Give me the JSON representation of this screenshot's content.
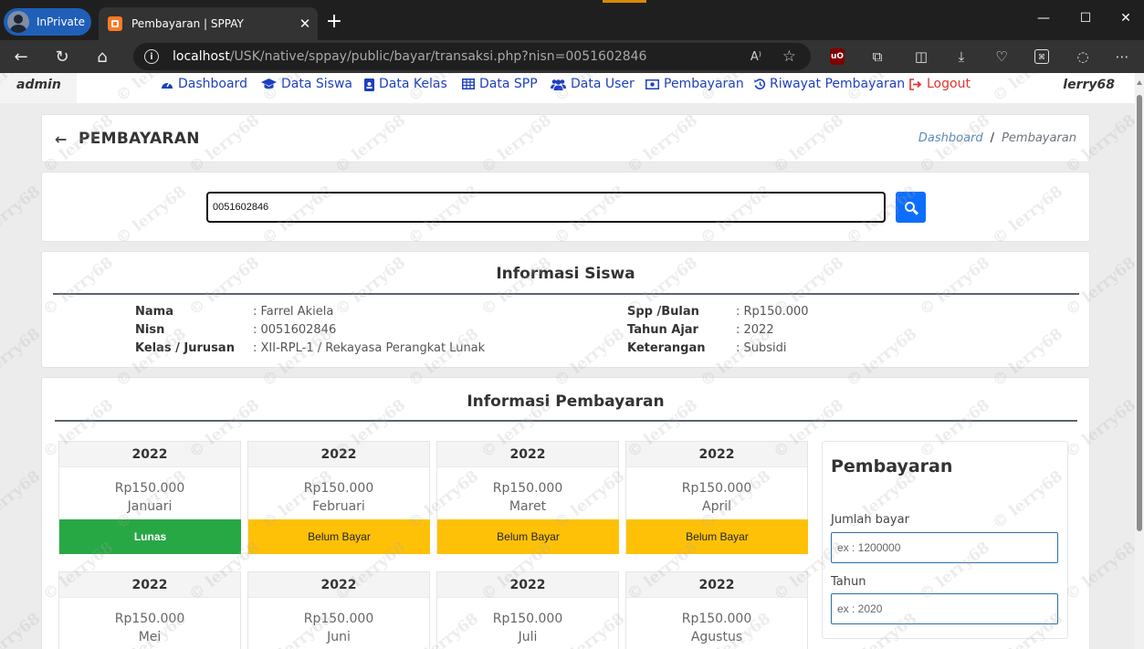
{
  "browser": {
    "inprivate_label": "InPrivate",
    "tab_title": "Pembayaran | SPPAY",
    "url_host": "localhost",
    "url_path": "/USK/native/sppay/public/bayar/transaksi.php?nisn=0051602846"
  },
  "nav": {
    "admin_label": "admin",
    "user_label": "lerry68",
    "links": [
      {
        "label": "Dashboard",
        "icon": "tachometer-icon"
      },
      {
        "label": "Data Siswa",
        "icon": "graduation-cap-icon"
      },
      {
        "label": "Data Kelas",
        "icon": "id-badge-icon"
      },
      {
        "label": "Data SPP",
        "icon": "table-icon"
      },
      {
        "label": "Data User",
        "icon": "users-icon"
      },
      {
        "label": "Pembayaran",
        "icon": "money-icon"
      },
      {
        "label": "Riwayat Pembayaran",
        "icon": "history-icon"
      },
      {
        "label": "Logout",
        "icon": "sign-out-icon"
      }
    ]
  },
  "header": {
    "title": "PEMBAYARAN",
    "breadcrumb": [
      "Dashboard",
      "Pembayaran"
    ]
  },
  "search": {
    "value": "0051602846"
  },
  "student": {
    "heading": "Informasi Siswa",
    "left": [
      {
        "key": "Nama",
        "value": ": Farrel Akiela"
      },
      {
        "key": "Nisn",
        "value": ": 0051602846"
      },
      {
        "key": "Kelas / Jurusan",
        "value": ": XII-RPL-1 / Rekayasa Perangkat Lunak"
      }
    ],
    "right": [
      {
        "key": "Spp /Bulan",
        "value": ": Rp150.000"
      },
      {
        "key": "Tahun Ajar",
        "value": ": 2022"
      },
      {
        "key": "Keterangan",
        "value": ": Subsidi"
      }
    ]
  },
  "payments": {
    "heading": "Informasi Pembayaran",
    "months": [
      {
        "year": "2022",
        "amount": "Rp150.000",
        "month": "Januari",
        "status": "Lunas",
        "paid": true
      },
      {
        "year": "2022",
        "amount": "Rp150.000",
        "month": "Februari",
        "status": "Belum Bayar",
        "paid": false
      },
      {
        "year": "2022",
        "amount": "Rp150.000",
        "month": "Maret",
        "status": "Belum Bayar",
        "paid": false
      },
      {
        "year": "2022",
        "amount": "Rp150.000",
        "month": "April",
        "status": "Belum Bayar",
        "paid": false
      },
      {
        "year": "2022",
        "amount": "Rp150.000",
        "month": "Mei",
        "status": "",
        "paid": false
      },
      {
        "year": "2022",
        "amount": "Rp150.000",
        "month": "Juni",
        "status": "",
        "paid": false
      },
      {
        "year": "2022",
        "amount": "Rp150.000",
        "month": "Juli",
        "status": "",
        "paid": false
      },
      {
        "year": "2022",
        "amount": "Rp150.000",
        "month": "Agustus",
        "status": "",
        "paid": false
      }
    ]
  },
  "form": {
    "title": "Pembayaran",
    "amount_label": "Jumlah bayar",
    "amount_placeholder": "ex : 1200000",
    "year_label": "Tahun",
    "year_placeholder": "ex : 2020"
  },
  "watermark": "© lerry68",
  "colors": {
    "nav_link": "#1d3fbf",
    "logout": "#e0342f",
    "paid": "#28a745",
    "unpaid": "#ffc107",
    "primary": "#0d6efd"
  }
}
